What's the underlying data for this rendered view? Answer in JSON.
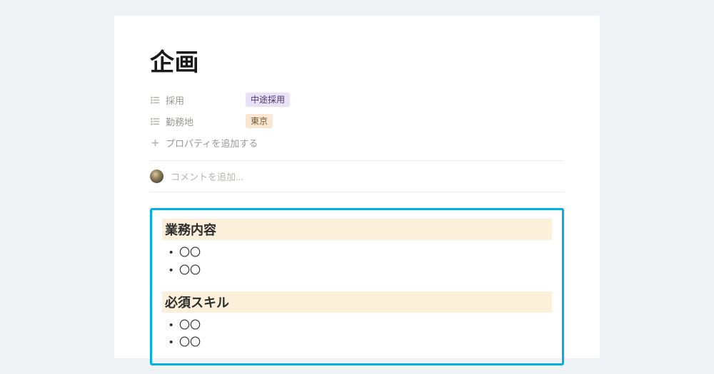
{
  "title": "企画",
  "properties": [
    {
      "label": "採用",
      "value": "中途採用",
      "pill": "purple"
    },
    {
      "label": "勤務地",
      "value": "東京",
      "pill": "orange"
    }
  ],
  "add_property_label": "プロパティを追加する",
  "comment_placeholder": "コメントを追加...",
  "sections": [
    {
      "heading": "業務内容",
      "items": [
        "〇〇",
        "〇〇"
      ]
    },
    {
      "heading": "必須スキル",
      "items": [
        "〇〇",
        "〇〇"
      ]
    }
  ]
}
